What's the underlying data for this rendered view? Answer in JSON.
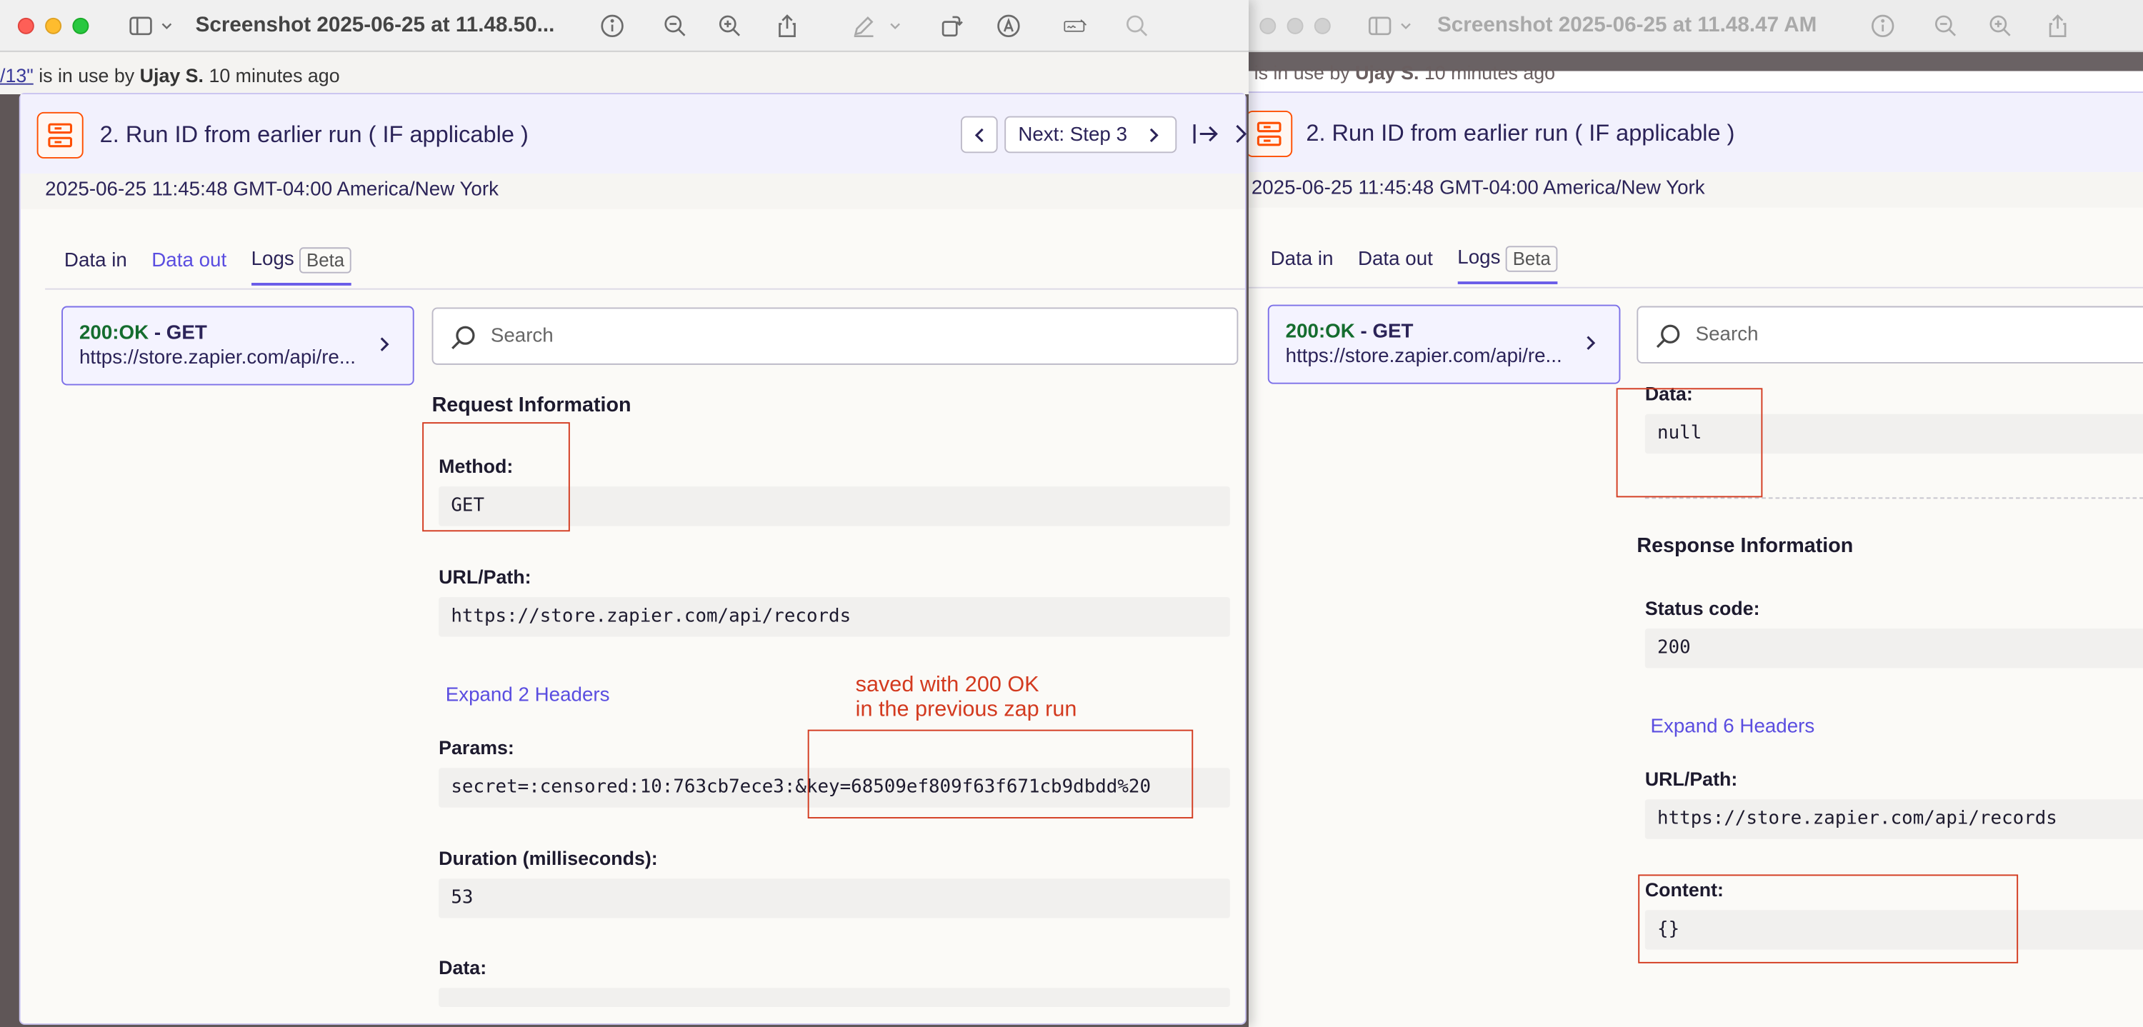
{
  "left_window": {
    "title": "Screenshot 2025-06-25 at 11.48.50...",
    "in_use_prefix": "/13\"",
    "in_use_text": " is in use by ",
    "in_use_user": "Ujay S.",
    "in_use_time": "10 minutes ago",
    "step_title": "2. Run ID from earlier run ( IF applicable )",
    "next_step_label": "Next: Step 3",
    "date": "2025-06-25 11:45:48 GMT-04:00 America/New York",
    "tabs": [
      {
        "label": "Data in"
      },
      {
        "label": "Data out"
      },
      {
        "label": "Logs",
        "badge": "Beta"
      }
    ],
    "request": {
      "status_code": "200:OK",
      "method_suffix": " - GET",
      "url_short": "https://store.zapier.com/api/re..."
    },
    "search_placeholder": "Search",
    "request_info_title": "Request Information",
    "fields": {
      "method_label": "Method:",
      "method_value": "GET",
      "url_label": "URL/Path:",
      "url_value": "https://store.zapier.com/api/records",
      "expand_headers": "Expand 2 Headers",
      "params_label": "Params:",
      "params_value": "secret=:censored:10:763cb7ece3:&key=68509ef809f63f671cb9dbdd%20",
      "duration_label": "Duration (milliseconds):",
      "duration_value": "53",
      "data_label": "Data:"
    },
    "annotation": {
      "line1": "saved with 200 OK",
      "line2": "in the previous zap run"
    }
  },
  "right_window": {
    "title": "Screenshot 2025-06-25 at 11.48.47 AM",
    "in_use_text": "is in use by ",
    "in_use_user": "Ujay S.",
    "in_use_time": "10 minutes ago",
    "step_title": "2. Run ID from earlier run ( IF applicable )",
    "date": "2025-06-25 11:45:48 GMT-04:00 America/New York",
    "tabs": [
      {
        "label": "Data in"
      },
      {
        "label": "Data out"
      },
      {
        "label": "Logs",
        "badge": "Beta"
      }
    ],
    "request": {
      "status_code": "200:OK",
      "method_suffix": " - GET",
      "url_short": "https://store.zapier.com/api/re..."
    },
    "search_placeholder": "Search",
    "fields": {
      "data_label": "Data:",
      "data_value": "null",
      "response_info_title": "Response Information",
      "status_label": "Status code:",
      "status_value": "200",
      "expand_headers": "Expand 6 Headers",
      "url_label": "URL/Path:",
      "url_value": "https://store.zapier.com/api/records",
      "content_label": "Content:",
      "content_value": "{}"
    }
  },
  "colors": {
    "accent": "#695be8",
    "link": "#5a4de0",
    "ok_green": "#146c2e",
    "annotation_red": "#d33a1f",
    "zapier_orange": "#ff4f00"
  }
}
